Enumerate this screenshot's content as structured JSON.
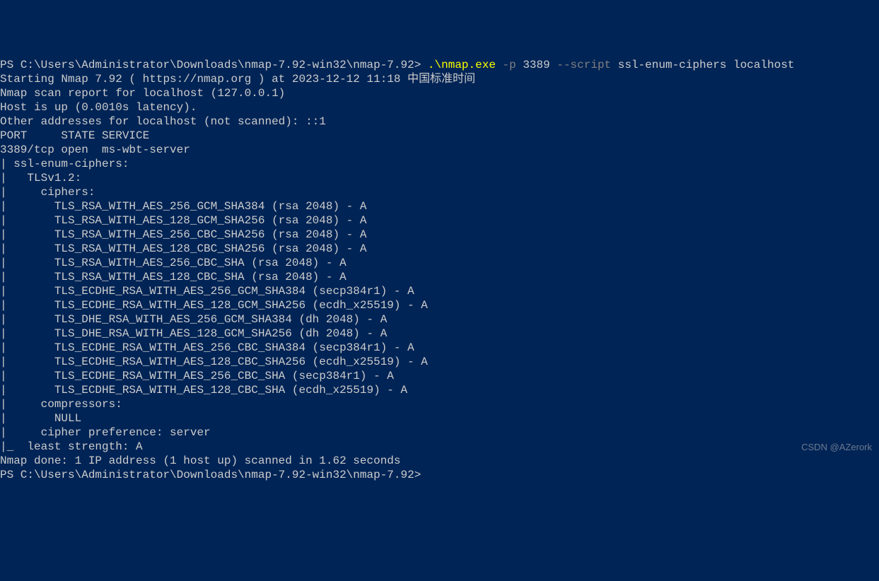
{
  "prompt1": {
    "path": "PS C:\\Users\\Administrator\\Downloads\\nmap-7.92-win32\\nmap-7.92> ",
    "cmd_exe": ".\\nmap.exe",
    "flag_p": " -p ",
    "port": "3389",
    "flag_script": " --script ",
    "script_args": "ssl-enum-ciphers localhost"
  },
  "output": {
    "l1": "Starting Nmap 7.92 ( https://nmap.org ) at 2023-12-12 11:18 中国标准时间",
    "l2": "Nmap scan report for localhost (127.0.0.1)",
    "l3": "Host is up (0.0010s latency).",
    "l4": "Other addresses for localhost (not scanned): ::1",
    "l5": "",
    "l6": "PORT     STATE SERVICE",
    "l7": "3389/tcp open  ms-wbt-server",
    "l8": "| ssl-enum-ciphers: ",
    "l9": "|   TLSv1.2: ",
    "l10": "|     ciphers: ",
    "l11": "|       TLS_RSA_WITH_AES_256_GCM_SHA384 (rsa 2048) - A",
    "l12": "|       TLS_RSA_WITH_AES_128_GCM_SHA256 (rsa 2048) - A",
    "l13": "|       TLS_RSA_WITH_AES_256_CBC_SHA256 (rsa 2048) - A",
    "l14": "|       TLS_RSA_WITH_AES_128_CBC_SHA256 (rsa 2048) - A",
    "l15": "|       TLS_RSA_WITH_AES_256_CBC_SHA (rsa 2048) - A",
    "l16": "|       TLS_RSA_WITH_AES_128_CBC_SHA (rsa 2048) - A",
    "l17": "|       TLS_ECDHE_RSA_WITH_AES_256_GCM_SHA384 (secp384r1) - A",
    "l18": "|       TLS_ECDHE_RSA_WITH_AES_128_GCM_SHA256 (ecdh_x25519) - A",
    "l19": "|       TLS_DHE_RSA_WITH_AES_256_GCM_SHA384 (dh 2048) - A",
    "l20": "|       TLS_DHE_RSA_WITH_AES_128_GCM_SHA256 (dh 2048) - A",
    "l21": "|       TLS_ECDHE_RSA_WITH_AES_256_CBC_SHA384 (secp384r1) - A",
    "l22": "|       TLS_ECDHE_RSA_WITH_AES_128_CBC_SHA256 (ecdh_x25519) - A",
    "l23": "|       TLS_ECDHE_RSA_WITH_AES_256_CBC_SHA (secp384r1) - A",
    "l24": "|       TLS_ECDHE_RSA_WITH_AES_128_CBC_SHA (ecdh_x25519) - A",
    "l25": "|     compressors: ",
    "l26": "|       NULL",
    "l27": "|     cipher preference: server",
    "l28": "|_  least strength: A",
    "l29": "",
    "l30": "Nmap done: 1 IP address (1 host up) scanned in 1.62 seconds"
  },
  "prompt2": {
    "path": "PS C:\\Users\\Administrator\\Downloads\\nmap-7.92-win32\\nmap-7.92> "
  },
  "watermark": "CSDN @AZerork"
}
